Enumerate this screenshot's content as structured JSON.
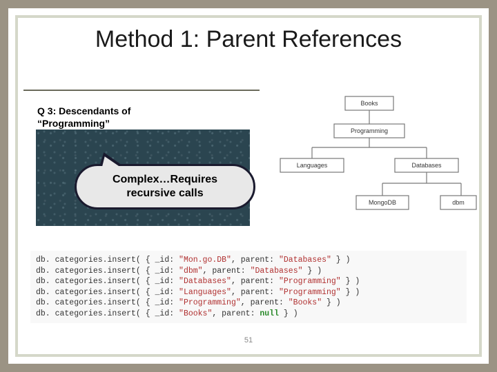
{
  "title": "Method 1: Parent References",
  "question": {
    "line1": "Q 3: Descendants of",
    "line2": "“Programming”"
  },
  "callout": {
    "line1": "Complex…Requires",
    "line2": "recursive calls"
  },
  "tree": {
    "root": "Books",
    "child": "Programming",
    "grandchildren": [
      "Languages",
      "Databases"
    ],
    "leaves": [
      "MongoDB",
      "dbm"
    ]
  },
  "code": {
    "prefix": "db. categories.insert( { _id: ",
    "midA": ", parent: ",
    "midNull": ", parent: ",
    "suffix": " } )",
    "rows": [
      {
        "id": "\"Mon.go.DB\"",
        "parent": "\"Databases\""
      },
      {
        "id": "\"dbm\"",
        "parent": "\"Databases\""
      },
      {
        "id": "\"Databases\"",
        "parent": "\"Programming\""
      },
      {
        "id": "\"Languages\"",
        "parent": "\"Programming\""
      },
      {
        "id": "\"Programming\"",
        "parent": "\"Books\""
      },
      {
        "id": "\"Books\"",
        "parent_null": "null"
      }
    ]
  },
  "page": "51"
}
